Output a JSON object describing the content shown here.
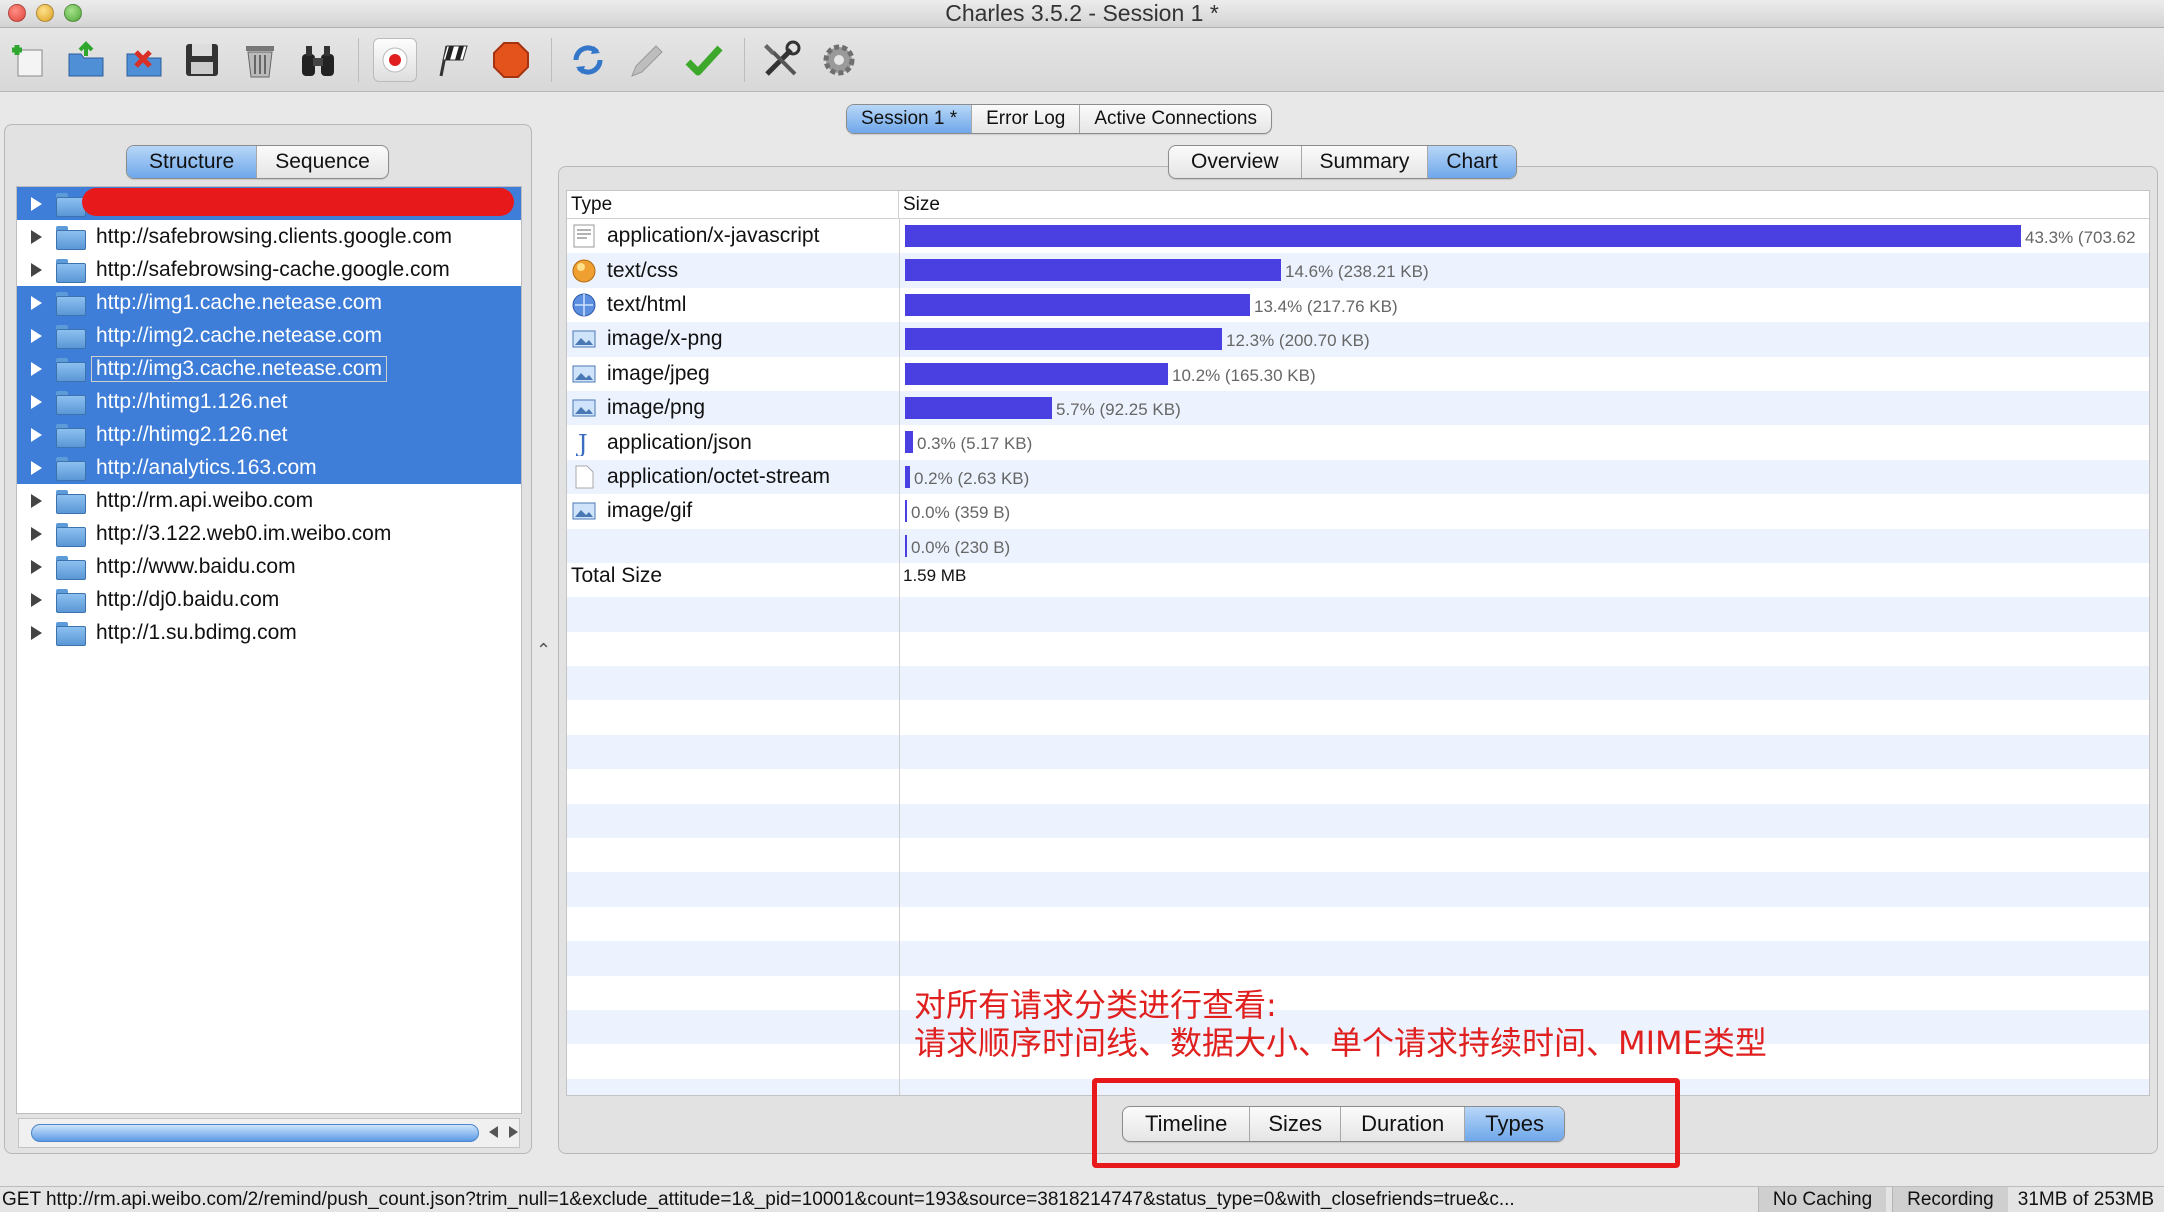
{
  "window": {
    "title": "Charles 3.5.2 - Session 1 *"
  },
  "toolbar": {
    "icons": [
      "new-session-icon",
      "open-icon",
      "close-session-icon",
      "save-icon",
      "clear-icon",
      "find-icon",
      "record-icon",
      "throttle-icon",
      "breakpoints-icon",
      "repeat-icon",
      "edit-icon",
      "validate-icon",
      "tools-icon",
      "settings-icon"
    ]
  },
  "session_tabs": [
    {
      "label": "Session 1 *",
      "active": true
    },
    {
      "label": "Error Log",
      "active": false
    },
    {
      "label": "Active Connections",
      "active": false
    }
  ],
  "view_tabs": [
    {
      "label": "Structure",
      "active": true
    },
    {
      "label": "Sequence",
      "active": false
    }
  ],
  "tree": [
    {
      "host": "",
      "selected": true,
      "redacted": true
    },
    {
      "host": "http://safebrowsing.clients.google.com",
      "selected": false
    },
    {
      "host": "http://safebrowsing-cache.google.com",
      "selected": false
    },
    {
      "host": "http://img1.cache.netease.com",
      "selected": true
    },
    {
      "host": "http://img2.cache.netease.com",
      "selected": true
    },
    {
      "host": "http://img3.cache.netease.com",
      "selected": true,
      "focus": true
    },
    {
      "host": "http://htimg1.126.net",
      "selected": true
    },
    {
      "host": "http://htimg2.126.net",
      "selected": true
    },
    {
      "host": "http://analytics.163.com",
      "selected": true
    },
    {
      "host": "http://rm.api.weibo.com",
      "selected": false
    },
    {
      "host": "http://3.122.web0.im.weibo.com",
      "selected": false
    },
    {
      "host": "http://www.baidu.com",
      "selected": false
    },
    {
      "host": "http://dj0.baidu.com",
      "selected": false
    },
    {
      "host": "http://1.su.bdimg.com",
      "selected": false
    }
  ],
  "detail_tabs": [
    {
      "label": "Overview",
      "active": false
    },
    {
      "label": "Summary",
      "active": false
    },
    {
      "label": "Chart",
      "active": true
    }
  ],
  "chart_tabs": [
    {
      "label": "Timeline",
      "active": false
    },
    {
      "label": "Sizes",
      "active": false
    },
    {
      "label": "Duration",
      "active": false
    },
    {
      "label": "Types",
      "active": true
    }
  ],
  "chart_data": {
    "type": "bar",
    "columns": [
      "Type",
      "Size"
    ],
    "rows": [
      {
        "type": "application/x-javascript",
        "icon": "script-icon",
        "percent": 43.3,
        "label": "43.3% (703.62"
      },
      {
        "type": "text/css",
        "icon": "css-icon",
        "percent": 14.6,
        "label": "14.6% (238.21 KB)"
      },
      {
        "type": "text/html",
        "icon": "html-icon",
        "percent": 13.4,
        "label": "13.4% (217.76 KB)"
      },
      {
        "type": "image/x-png",
        "icon": "image-icon",
        "percent": 12.3,
        "label": "12.3% (200.70 KB)"
      },
      {
        "type": "image/jpeg",
        "icon": "image-icon",
        "percent": 10.2,
        "label": "10.2% (165.30 KB)"
      },
      {
        "type": "image/png",
        "icon": "image-icon",
        "percent": 5.7,
        "label": "5.7% (92.25 KB)"
      },
      {
        "type": "application/json",
        "icon": "json-icon",
        "percent": 0.3,
        "label": "0.3% (5.17 KB)"
      },
      {
        "type": "application/octet-stream",
        "icon": "file-icon",
        "percent": 0.2,
        "label": "0.2% (2.63 KB)"
      },
      {
        "type": "image/gif",
        "icon": "image-icon",
        "percent": 0.0,
        "label": "0.0% (359 B)"
      },
      {
        "type": "",
        "icon": "",
        "percent": 0.0,
        "label": "0.0% (230 B)"
      }
    ],
    "total_label": "Total Size",
    "total_value": "1.59 MB",
    "bar_color": "#4a3fe0"
  },
  "annotation": {
    "line1": "对所有请求分类进行查看:",
    "line2": "请求顺序时间线、数据大小、单个请求持续时间、MIME类型"
  },
  "status": {
    "url": "GET http://rm.api.weibo.com/2/remind/push_count.json?trim_null=1&exclude_attitude=1&_pid=10001&count=193&source=3818214747&status_type=0&with_closefriends=true&c...",
    "no_caching": "No Caching",
    "recording": "Recording",
    "memory": "31MB of 253MB"
  }
}
